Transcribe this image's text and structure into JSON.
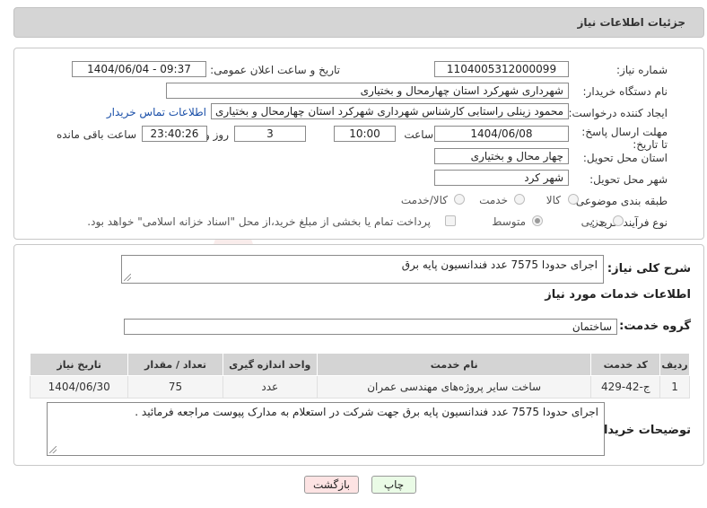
{
  "header": {
    "title": "جزئیات اطلاعات نیاز"
  },
  "form": {
    "need_number_label": "شماره نیاز:",
    "need_number": "1104005312000099",
    "announce_label": "تاریخ و ساعت اعلان عمومی:",
    "announce_value": "1404/06/04 - 09:37",
    "buyer_org_label": "نام دستگاه خریدار:",
    "buyer_org": "شهرداری شهرکرد استان چهارمحال و بختیاری",
    "creator_label": "ایجاد کننده درخواست:",
    "creator": "محمود زینلی راستابی کارشناس شهرداری شهرکرد استان چهارمحال و بختیاری",
    "contact_link": "اطلاعات تماس خریدار",
    "deadline_label": "مهلت ارسال پاسخ: تا تاریخ:",
    "deadline_date": "1404/06/08",
    "time_label": "ساعت",
    "deadline_time": "10:00",
    "days_value": "3",
    "days_label": "روز و",
    "remaining_time": "23:40:26",
    "remaining_label": "ساعت باقی مانده",
    "province_label": "استان محل تحویل:",
    "province": "چهار محال و بختیاری",
    "city_label": "شهر محل تحویل:",
    "city": "شهر کرد",
    "category_label": "طبقه بندی موضوعی:",
    "category_options": [
      "کالا",
      "خدمت",
      "کالا/خدمت"
    ],
    "process_label": "نوع فرآیند خرید :",
    "process_options": [
      "جزیی",
      "متوسط"
    ],
    "payment_note": "پرداخت تمام یا بخشی از مبلغ خرید،از محل \"اسناد خزانه اسلامی\" خواهد بود."
  },
  "details": {
    "summary_label": "شرح کلی نیاز:",
    "summary": "اجرای حدودا 7575 عدد فندانسیون پایه برق",
    "services_title": "اطلاعات خدمات مورد نیاز",
    "service_group_label": "گروه خدمت:",
    "service_group": "ساختمان",
    "table_headers": [
      "ردیف",
      "کد خدمت",
      "نام خدمت",
      "واحد اندازه گیری",
      "تعداد / مقدار",
      "تاریخ نیاز"
    ],
    "table_rows": [
      [
        "1",
        "ج-42-429",
        "ساخت سایر پروژه‌های مهندسی عمران",
        "عدد",
        "75",
        "1404/06/30"
      ]
    ],
    "buyer_notes_label": "توضیحات خریدار:",
    "buyer_notes": "اجرای حدودا 7575 عدد فندانسیون پایه برق جهت شرکت در استعلام به مدارک پیوست مراجعه فرمائید ."
  },
  "buttons": {
    "print": "چاپ",
    "back": "بازگشت"
  },
  "watermark": {
    "text": "AriaTender.neT"
  },
  "colors": {
    "link": "#1a4fa8",
    "header_bg": "#d5d5d5",
    "back_button_bg": "#fde3e3",
    "print_button_bg": "#eafbe6"
  }
}
